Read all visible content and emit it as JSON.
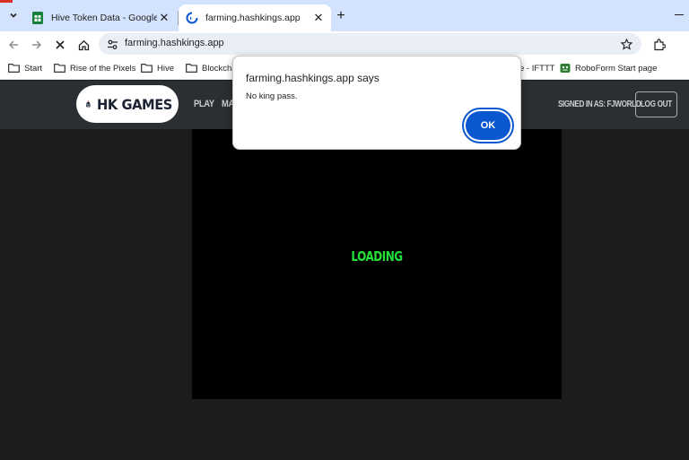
{
  "browser": {
    "tabs": [
      {
        "title": "Hive Token Data - Google Sheets",
        "active": false,
        "favicon": "google-sheets-icon"
      },
      {
        "title": "farming.hashkings.app",
        "active": true,
        "favicon": "loading-spinner-icon"
      }
    ],
    "new_tab_symbol": "+",
    "url": "farming.hashkings.app",
    "bookmarks": [
      {
        "label": "Start",
        "icon": "folder-icon"
      },
      {
        "label": "Rise of the Pixels",
        "icon": "folder-icon"
      },
      {
        "label": "Hive",
        "icon": "folder-icon"
      },
      {
        "label": "Blockcha",
        "icon": "folder-icon"
      },
      {
        "label": "e - IFTTT",
        "icon": "none"
      },
      {
        "label": "RoboForm Start page",
        "icon": "roboform-icon"
      }
    ]
  },
  "site": {
    "logo_text": "HK GAMES",
    "nav": [
      "PLAY",
      "MA"
    ],
    "signed_in": "SIGNED IN AS: FJWORLD",
    "logout_label": "LOG OUT"
  },
  "game": {
    "loading_text": "LOADING"
  },
  "dialog": {
    "title": "farming.hashkings.app says",
    "message": "No king pass.",
    "ok_label": "OK"
  },
  "colors": {
    "tabstrip_bg": "#d3e3fd",
    "header_bg": "#2b2f33",
    "page_bg": "#1c1c1c",
    "loading_text": "#22e23a",
    "dialog_button": "#0b57d0"
  }
}
